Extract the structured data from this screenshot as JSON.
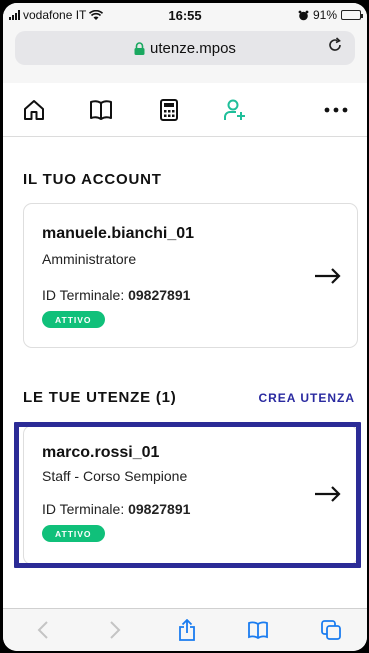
{
  "status_bar": {
    "carrier": "vodafone IT",
    "time": "16:55",
    "battery": "91%"
  },
  "browser": {
    "url": "utenze.mpos"
  },
  "nav": {
    "icons": [
      "home-icon",
      "book-icon",
      "calculator-icon",
      "add-user-icon",
      "more-icon"
    ],
    "active_icon": "add-user-icon"
  },
  "account_section": {
    "title": "IL TUO ACCOUNT",
    "card": {
      "username": "manuele.bianchi_01",
      "role": "Amministratore",
      "terminal_label": "ID Terminale:",
      "terminal_id": "09827891",
      "status": "ATTIVO"
    }
  },
  "users_section": {
    "title": "LE TUE UTENZE (1)",
    "create_label": "CREA UTENZA",
    "users": [
      {
        "username": "marco.rossi_01",
        "role": "Staff - Corso Sempione",
        "terminal_label": "ID Terminale:",
        "terminal_id": "09827891",
        "status": "ATTIVO"
      }
    ]
  },
  "colors": {
    "accent": "#2b2b96",
    "active_badge": "#10c07a",
    "nav_active": "#1fbf9a"
  }
}
